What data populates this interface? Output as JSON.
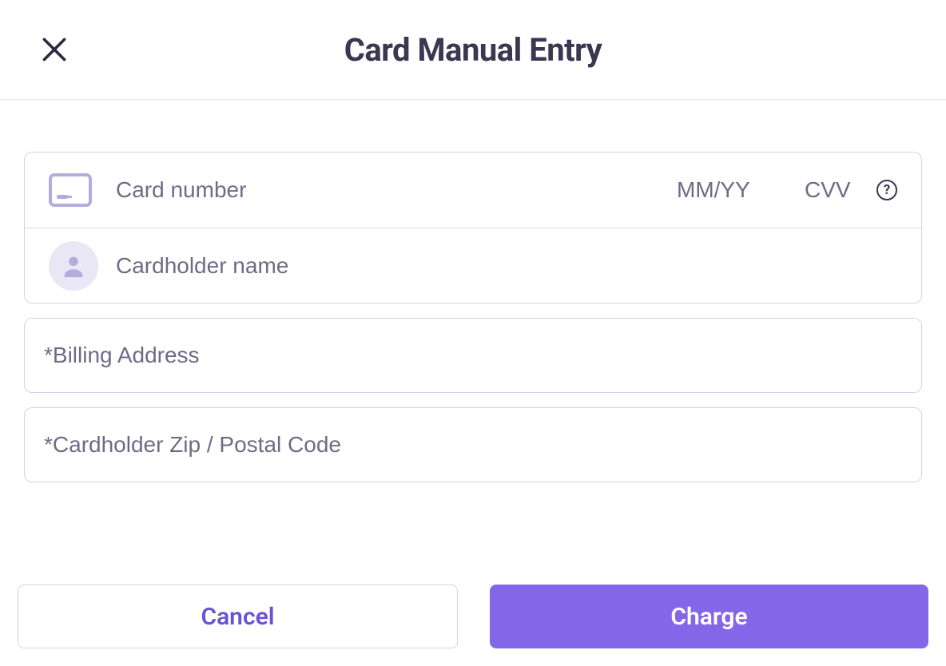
{
  "header": {
    "title": "Card Manual Entry"
  },
  "card": {
    "number_placeholder": "Card number",
    "number_value": "",
    "expiry_placeholder": "MM/YY",
    "expiry_value": "",
    "cvv_placeholder": "CVV",
    "cvv_value": "",
    "name_placeholder": "Cardholder name",
    "name_value": ""
  },
  "billing": {
    "address_placeholder": "*Billing Address",
    "address_value": "",
    "zip_placeholder": "*Cardholder Zip / Postal Code",
    "zip_value": ""
  },
  "footer": {
    "cancel_label": "Cancel",
    "charge_label": "Charge"
  },
  "icons": {
    "help_glyph": "?"
  }
}
